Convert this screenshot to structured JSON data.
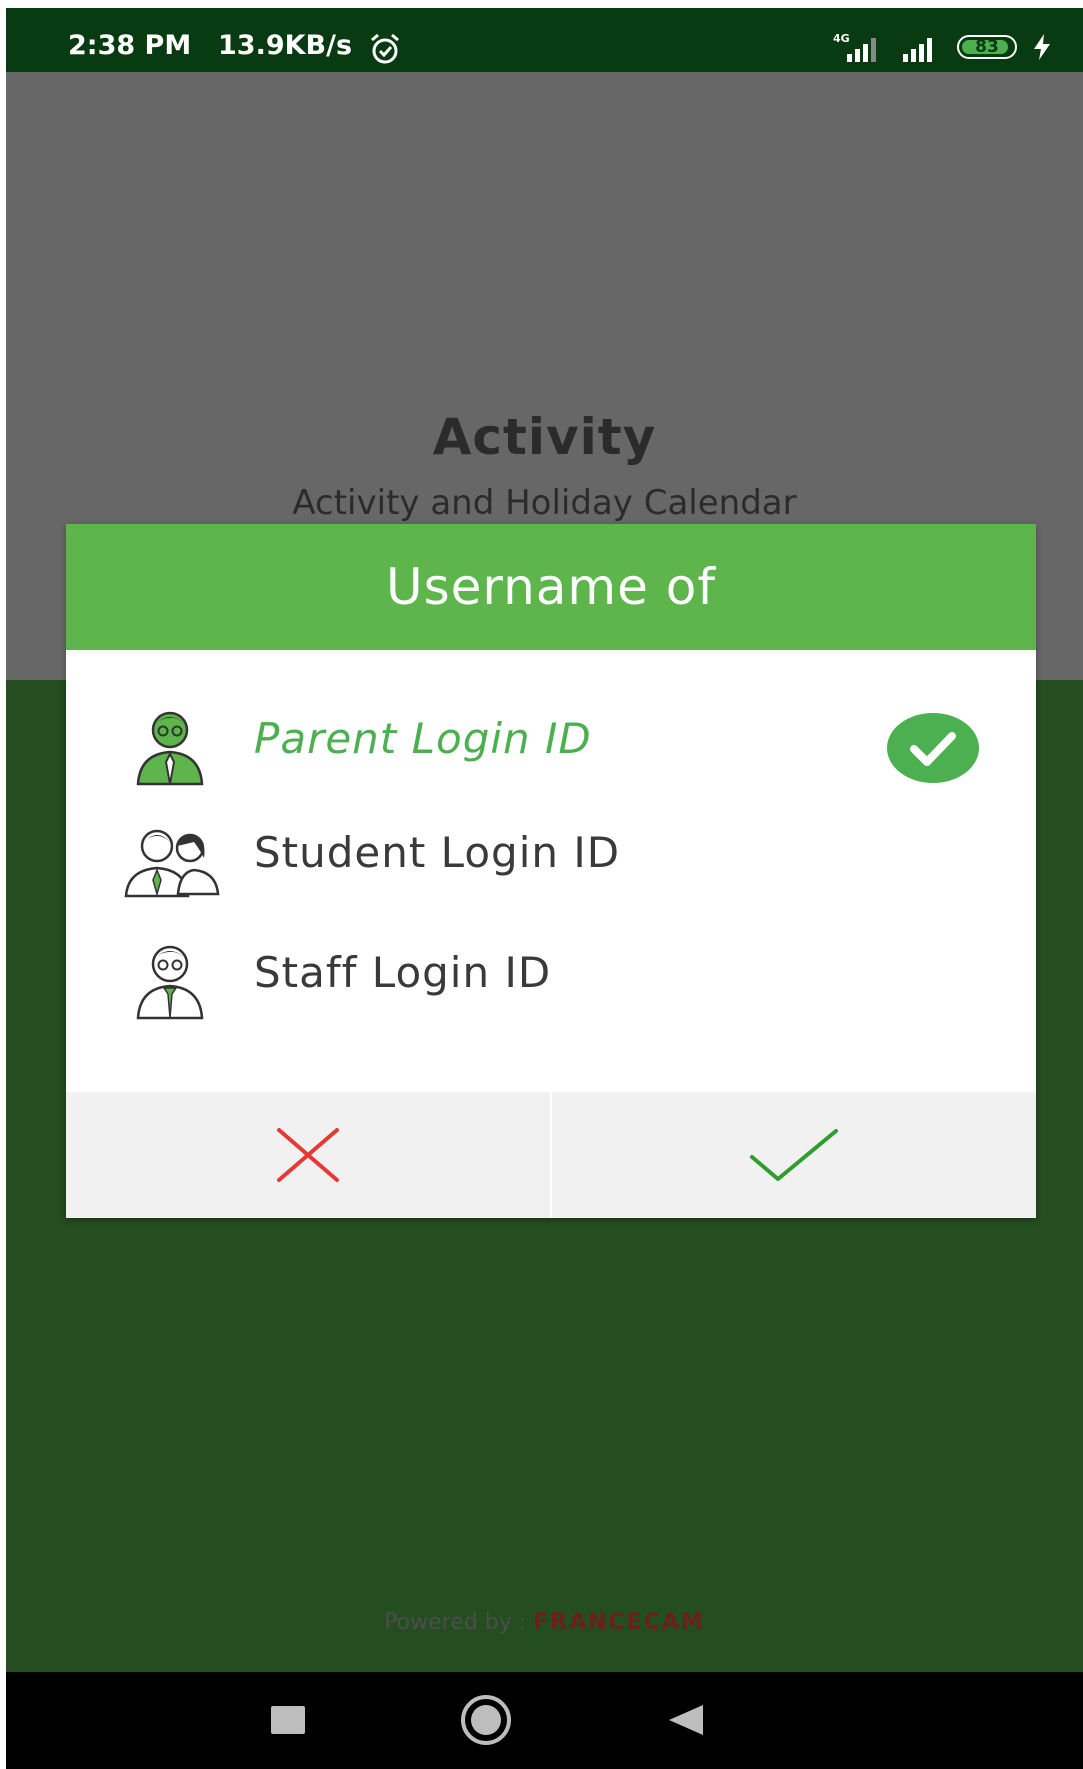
{
  "status_bar": {
    "time": "2:38 PM",
    "speed": "13.9KB/s",
    "network": "4G",
    "battery": "83",
    "icons": [
      "alarm-icon",
      "signal-4g-icon",
      "signal-icon",
      "battery-icon",
      "charging-icon"
    ]
  },
  "background": {
    "title": "Activity",
    "subtitle": "Activity and Holiday Calendar"
  },
  "dialog": {
    "title": "Username of",
    "options": [
      {
        "label": "Parent Login ID",
        "icon": "parent-avatar-icon",
        "selected": true
      },
      {
        "label": "Student Login ID",
        "icon": "students-avatar-icon",
        "selected": false
      },
      {
        "label": "Staff Login ID",
        "icon": "staff-avatar-icon",
        "selected": false
      }
    ],
    "cancel_icon": "close-icon",
    "confirm_icon": "check-icon"
  },
  "footer": {
    "powered_by": "Powered by :",
    "brand": "FRANCECAM"
  },
  "nav_bar": {
    "buttons": [
      "recents-square-icon",
      "home-circle-icon",
      "back-triangle-icon"
    ]
  },
  "colors": {
    "status_bar": "#093b12",
    "overlay_gray": "#676767",
    "app_green_dark": "#244d20",
    "dialog_header": "#5db54c",
    "selected_text": "#4caf50",
    "cancel_red": "#e53935",
    "confirm_green": "#2e9e2e"
  }
}
